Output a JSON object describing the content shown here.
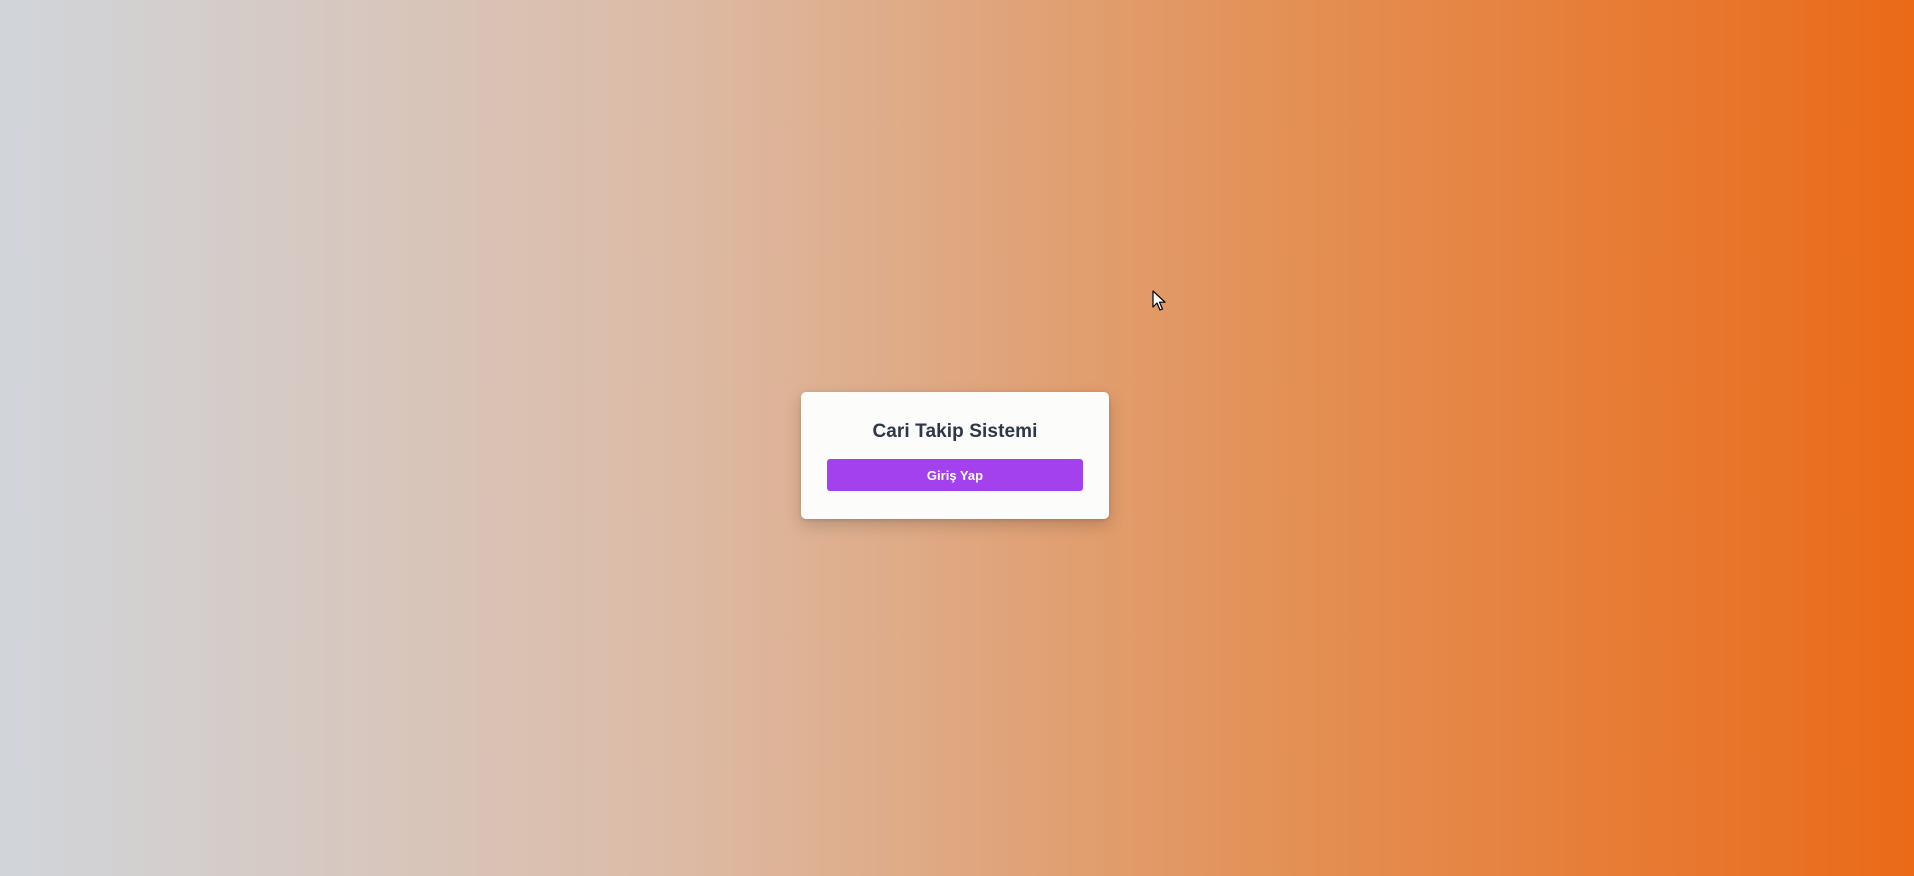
{
  "login": {
    "title": "Cari Takip Sistemi",
    "button_label": "Giriş Yap"
  },
  "colors": {
    "gradient_start": "#d1d5db",
    "gradient_end": "#ea6a18",
    "button": "#a341ef",
    "title": "#2d3748"
  },
  "cursor": {
    "icon": "mouse-pointer-icon"
  }
}
